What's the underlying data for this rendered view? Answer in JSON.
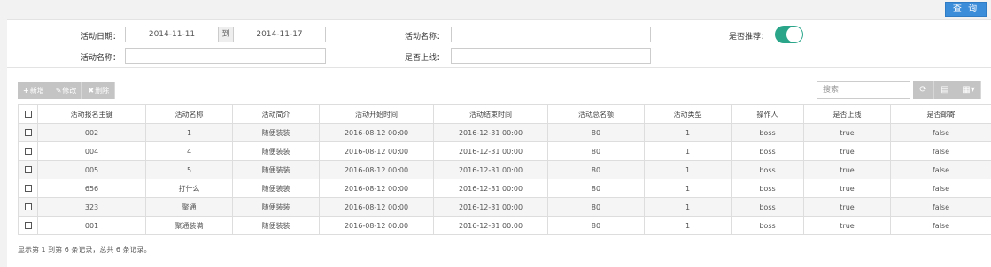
{
  "toolbar_top": {
    "query_label": "查 询"
  },
  "filters": {
    "activity_date_label": "活动日期：",
    "date_from": "2014-11-11",
    "date_to_sep": "到",
    "date_to": "2014-11-17",
    "activity_name_label_1": "活动名称：",
    "activity_name_value_1": "",
    "recommend_label": "是否推荐：",
    "recommend_on": true,
    "activity_name_label_2": "活动名称：",
    "activity_name_value_2": "",
    "online_label": "是否上线：",
    "online_value": ""
  },
  "grid_toolbar": {
    "add_icon": "plus-icon",
    "add_label": "新增",
    "edit_icon": "pencil-icon",
    "edit_label": "修改",
    "delete_icon": "times-icon",
    "delete_label": "删除",
    "search_placeholder": "搜索",
    "refresh_icon": "refresh-icon",
    "toggle_icon": "list-toggle-icon",
    "columns_icon": "columns-icon"
  },
  "table": {
    "columns": [
      "活动报名主键",
      "活动名称",
      "活动简介",
      "活动开始时间",
      "活动结束时间",
      "活动总名额",
      "活动类型",
      "操作人",
      "是否上线",
      "是否邮寄"
    ],
    "rows": [
      [
        "002",
        "1",
        "随便装装",
        "2016-08-12 00:00",
        "2016-12-31 00:00",
        "80",
        "1",
        "boss",
        "true",
        "false"
      ],
      [
        "004",
        "4",
        "随便装装",
        "2016-08-12 00:00",
        "2016-12-31 00:00",
        "80",
        "1",
        "boss",
        "true",
        "false"
      ],
      [
        "005",
        "5",
        "随便装装",
        "2016-08-12 00:00",
        "2016-12-31 00:00",
        "80",
        "1",
        "boss",
        "true",
        "false"
      ],
      [
        "656",
        "打什么",
        "随便装装",
        "2016-08-12 00:00",
        "2016-12-31 00:00",
        "80",
        "1",
        "boss",
        "true",
        "false"
      ],
      [
        "323",
        "聚通",
        "随便装装",
        "2016-08-12 00:00",
        "2016-12-31 00:00",
        "80",
        "1",
        "boss",
        "true",
        "false"
      ],
      [
        "001",
        "聚通装满",
        "随便装装",
        "2016-08-12 00:00",
        "2016-12-31 00:00",
        "80",
        "1",
        "boss",
        "true",
        "false"
      ]
    ]
  },
  "footer": {
    "pagination_text": "显示第 1 到第 6 条记录，总共 6 条记录。"
  },
  "colors": {
    "accent": "#3c8dd9",
    "toggle_on": "#2aa58a",
    "toolbar_button": "#c4c4c4"
  }
}
